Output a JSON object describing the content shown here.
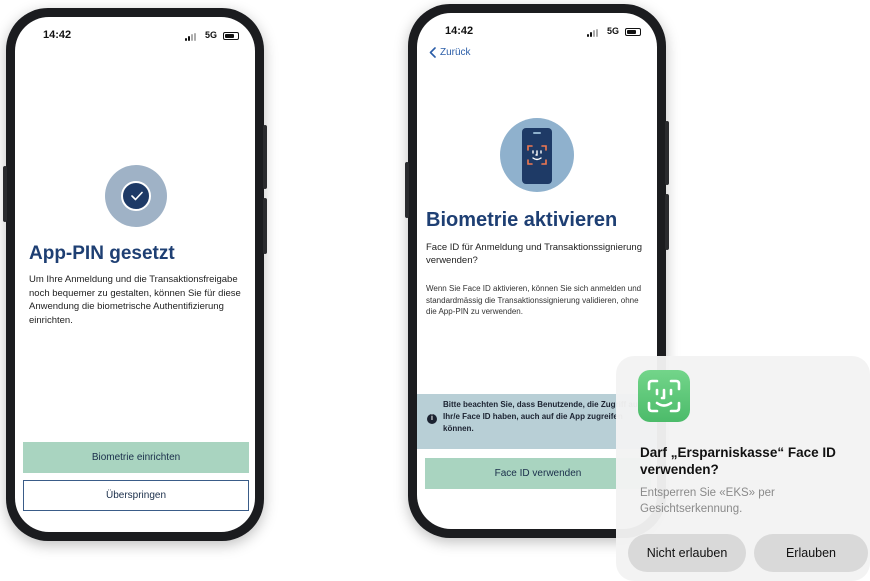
{
  "phone1": {
    "status": {
      "time": "14:42",
      "network": "5G"
    },
    "title": "App-PIN gesetzt",
    "body": "Um Ihre Anmeldung und die Transaktionsfreigabe noch bequemer zu gestalten, können Sie für diese Anwendung die biometrische Authentifizierung einrichten.",
    "primary_button": "Biometrie einrichten",
    "secondary_button": "Überspringen"
  },
  "phone2": {
    "status": {
      "time": "14:42",
      "network": "5G"
    },
    "back_label": "Zurück",
    "title": "Biometrie aktivieren",
    "subtitle": "Face ID für Anmeldung und Transaktionssignierung verwenden?",
    "body": "Wenn Sie Face ID aktivieren, können Sie sich anmelden und standardmässig die Transaktionssignierung validieren, ohne die App-PIN zu verwenden.",
    "notice": "Bitte beachten Sie, dass Benutzende, die Zugriff auf Ihr/e Face ID haben, auch auf die App zugreifen können.",
    "primary_button": "Face ID verwenden"
  },
  "dialog": {
    "title": "Darf „Ersparniskasse“ Face ID verwenden?",
    "message": "Entsperren Sie «EKS» per Gesichtserkennung.",
    "deny_button": "Nicht erlauben",
    "allow_button": "Erlauben"
  },
  "colors": {
    "brand_blue": "#1e3f73",
    "primary_green": "#a9d4c0",
    "notice_bg": "#b8cfd6",
    "faceid_green": "#4cbb6a"
  },
  "icons": [
    "checkmark-icon",
    "face-id-icon",
    "chevron-left-icon",
    "info-icon",
    "signal-icon",
    "battery-icon"
  ]
}
